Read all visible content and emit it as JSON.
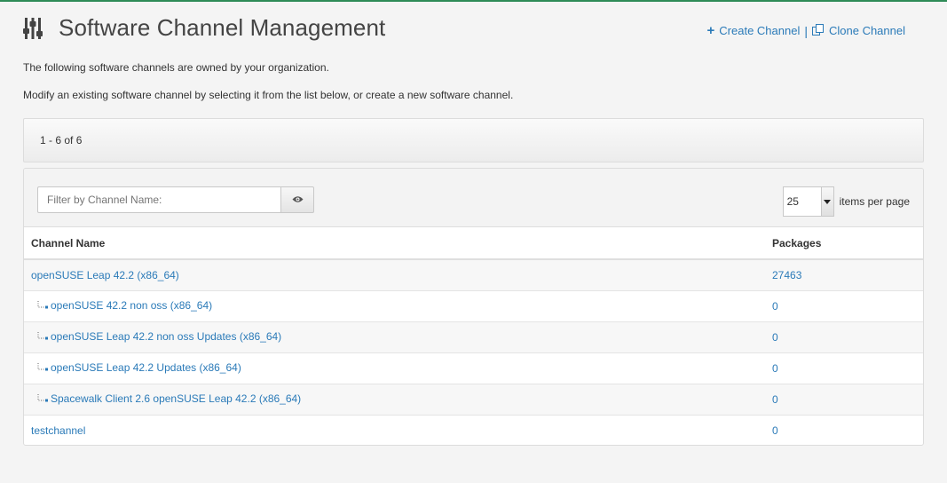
{
  "header": {
    "title": "Software Channel Management",
    "icon": "sliders-icon",
    "create_label": "Create Channel",
    "separator": "|",
    "clone_label": "Clone Channel"
  },
  "description": {
    "line1": "The following software channels are owned by your organization.",
    "line2": "Modify an existing software channel by selecting it from the list below, or create a new software channel."
  },
  "pagination": {
    "range": "1 - 6 of 6"
  },
  "filter": {
    "placeholder": "Filter by Channel Name:"
  },
  "per_page": {
    "value": "25",
    "label": "items per page"
  },
  "table": {
    "headers": {
      "name": "Channel Name",
      "packages": "Packages"
    },
    "rows": [
      {
        "name": "openSUSE Leap 42.2 (x86_64)",
        "packages": "27463",
        "child": false
      },
      {
        "name": "openSUSE 42.2 non oss (x86_64)",
        "packages": "0",
        "child": true
      },
      {
        "name": "openSUSE Leap 42.2 non oss Updates (x86_64)",
        "packages": "0",
        "child": true
      },
      {
        "name": "openSUSE Leap 42.2 Updates (x86_64)",
        "packages": "0",
        "child": true
      },
      {
        "name": "Spacewalk Client 2.6 openSUSE Leap 42.2 (x86_64)",
        "packages": "0",
        "child": true
      },
      {
        "name": "testchannel",
        "packages": "0",
        "child": false
      }
    ]
  },
  "colors": {
    "link": "#2a7ab8",
    "accent_top": "#2e8b57"
  }
}
